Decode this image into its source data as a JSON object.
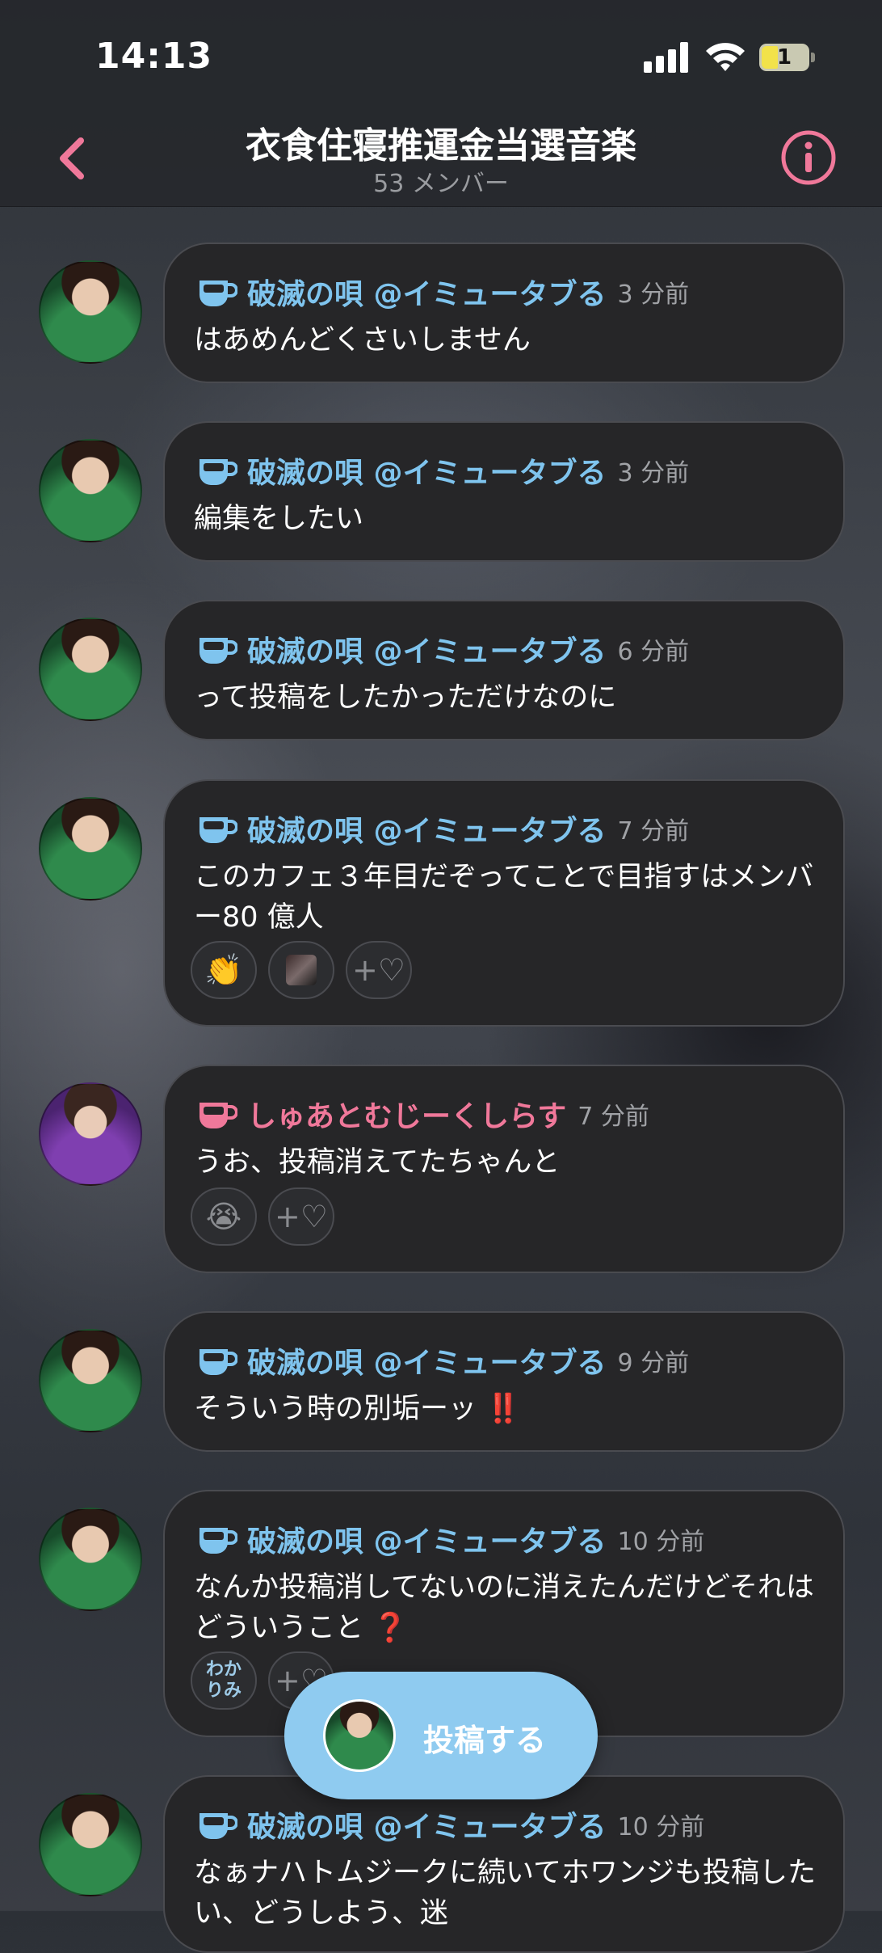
{
  "status": {
    "time": "14:13",
    "battery": "1"
  },
  "header": {
    "title": "衣食住寝推運金当選音楽",
    "members": "53 メンバー"
  },
  "colors": {
    "accent_pink": "#f0789a",
    "name_blue": "#7fc4ee",
    "post_button": "#8fcbf0"
  },
  "messages": [
    {
      "name": "破滅の唄 @イミュータブる",
      "ago": "3 分前",
      "text": "はあめんどくさいしません"
    },
    {
      "name": "破滅の唄 @イミュータブる",
      "ago": "3 分前",
      "text": "編集をしたい"
    },
    {
      "name": "破滅の唄 @イミュータブる",
      "ago": "6 分前",
      "text": "って投稿をしたかっただけなのに"
    },
    {
      "name": "破滅の唄 @イミュータブる",
      "ago": "7 分前",
      "text": "このカフェ３年目だぞってことで目指すはメンバー80 億人",
      "reactions": [
        "👏",
        "image",
        "+♡"
      ]
    },
    {
      "name": "しゅあとむじーくしらす",
      "ago": "7 分前",
      "text": "うお、投稿消えてたちゃんと",
      "reactions": [
        "😭",
        "+♡"
      ]
    },
    {
      "name": "破滅の唄 @イミュータブる",
      "ago": "9 分前",
      "text": "そういう時の別垢ーッ",
      "emoji": "‼️"
    },
    {
      "name": "破滅の唄 @イミュータブる",
      "ago": "10 分前",
      "text": "なんか投稿消してないのに消えたんだけどそれはどういうこと",
      "emoji": "❓",
      "reactions": [
        "わかりみ",
        "+♡"
      ]
    },
    {
      "name": "破滅の唄 @イミュータブる",
      "ago": "10 分前",
      "text": "なぁナハトムジークに続いてホワンジも投稿したい、どうしよう、迷"
    }
  ],
  "post_button": {
    "label": "投稿する"
  }
}
